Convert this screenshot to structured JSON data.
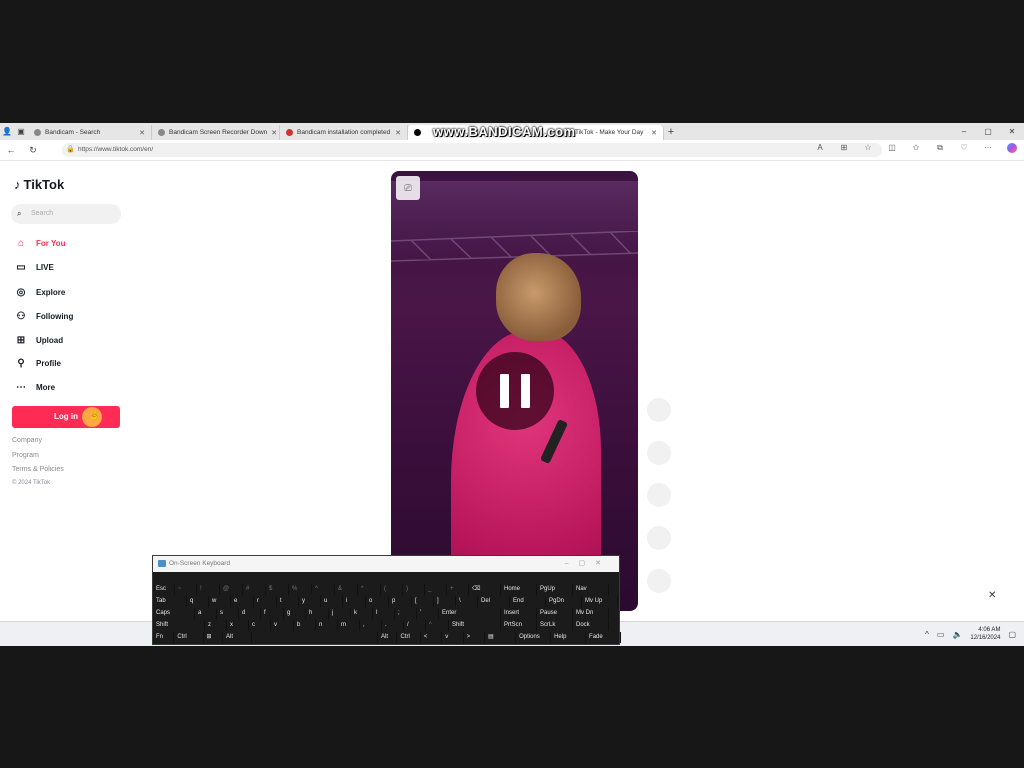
{
  "browser": {
    "tabs": [
      {
        "title": "Bandicam - Search",
        "active": false
      },
      {
        "title": "Bandicam Screen Recorder Down",
        "active": false
      },
      {
        "title": "Bandicam installation completed",
        "active": false
      },
      {
        "title": "TikTok - Make Your Day",
        "active": true
      }
    ],
    "new_tab_label": "+",
    "window_controls": [
      "–",
      "▢",
      "✕"
    ],
    "url": "https://www.tiktok.com/en/"
  },
  "watermark": "www.BANDICAM.com",
  "sidebar": {
    "logo": "TikTok",
    "search_placeholder": "Search",
    "nav": [
      {
        "label": "For You",
        "icon": "home-icon",
        "active": true
      },
      {
        "label": "LIVE",
        "icon": "live-icon",
        "active": false
      },
      {
        "label": "Explore",
        "icon": "compass-icon",
        "active": false
      },
      {
        "label": "Following",
        "icon": "following-icon",
        "active": false
      },
      {
        "label": "Upload",
        "icon": "upload-icon",
        "active": false
      },
      {
        "label": "Profile",
        "icon": "profile-icon",
        "active": false
      },
      {
        "label": "More",
        "icon": "more-icon",
        "active": false
      }
    ],
    "login_label": "Log in",
    "footer": [
      "Company",
      "Program",
      "Terms & Policies",
      "© 2024 TikTok"
    ]
  },
  "video": {
    "state": "paused"
  },
  "osk": {
    "title": "On-Screen Keyboard",
    "rows": [
      [
        "Esc",
        "~",
        "!",
        "@",
        "#",
        "$",
        "%",
        "^",
        "&",
        "*",
        "(",
        ")",
        "_",
        "+",
        "⌫",
        "Home",
        "PgUp",
        "Nav"
      ],
      [
        "Tab",
        "q",
        "w",
        "e",
        "r",
        "t",
        "y",
        "u",
        "i",
        "o",
        "p",
        "[",
        "]",
        "\\",
        "Del",
        "End",
        "PgDn",
        "Mv Up"
      ],
      [
        "Caps",
        "a",
        "s",
        "d",
        "f",
        "g",
        "h",
        "j",
        "k",
        "l",
        ";",
        "'",
        "Enter",
        "Insert",
        "Pause",
        "Mv Dn"
      ],
      [
        "Shift",
        "z",
        "x",
        "c",
        "v",
        "b",
        "n",
        "m",
        ",",
        ".",
        "/",
        "^",
        "Shift",
        "PrtScn",
        "ScrLk",
        "Dock"
      ],
      [
        "Fn",
        "Ctrl",
        "⊞",
        "Alt",
        "",
        "Alt",
        "Ctrl",
        "<",
        "v",
        ">",
        "▤",
        "Options",
        "Help",
        "Fade"
      ]
    ]
  },
  "taskbar": {
    "time": "4:06 AM",
    "date": "12/16/2024"
  },
  "colors": {
    "accent": "#fe2c55",
    "text": "#161823",
    "screen_bg": "#171717"
  }
}
